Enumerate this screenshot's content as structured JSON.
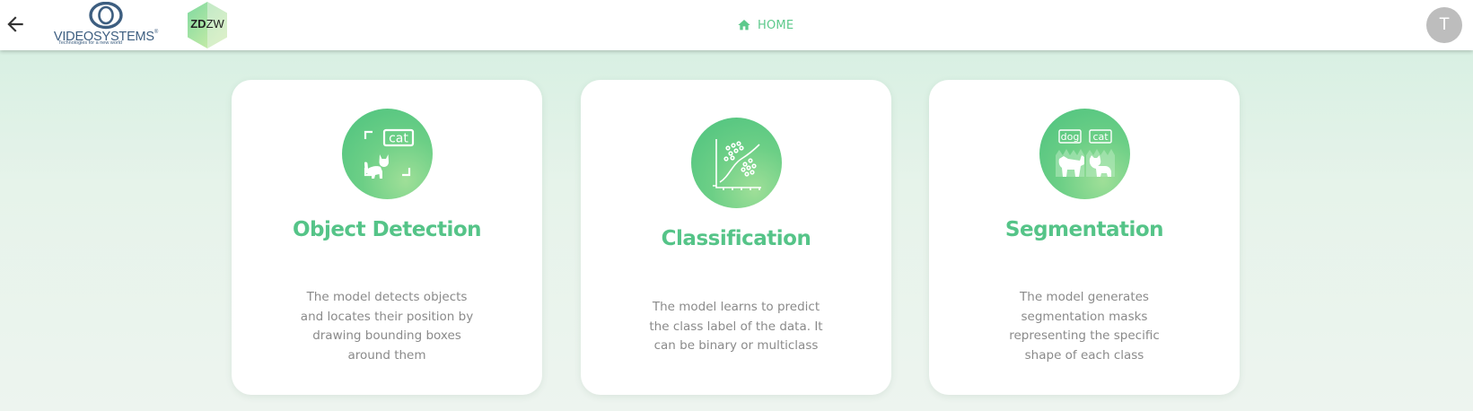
{
  "header": {
    "back_icon": "arrow-left-icon",
    "brand": {
      "name": "VIDEOSYSTEMS",
      "registered": "®",
      "tagline": "Technologies for a new world"
    },
    "partner_logo": {
      "part1": "ZD",
      "part2": "ZW"
    },
    "nav": {
      "home_label": "HOME",
      "home_icon": "home-icon"
    },
    "avatar_initial": "T"
  },
  "cards": [
    {
      "title": "Object Detection",
      "description": "The model detects objects and locates their position by drawing bounding boxes around them",
      "icon": "object-detection-icon",
      "icon_label": "cat"
    },
    {
      "title": "Classification",
      "description": "The model learns to predict the class label of the data. It can be binary or multiclass",
      "icon": "classification-icon"
    },
    {
      "title": "Segmentation",
      "description": "The model generates segmentation masks representing the specific shape of each class",
      "icon": "segmentation-icon",
      "icon_labels": [
        "dog",
        "cat"
      ]
    }
  ],
  "colors": {
    "accent": "#55c488",
    "text_muted": "#8a8a8a",
    "brand_blue": "#3d5e80",
    "avatar_bg": "#bdbdbd"
  }
}
